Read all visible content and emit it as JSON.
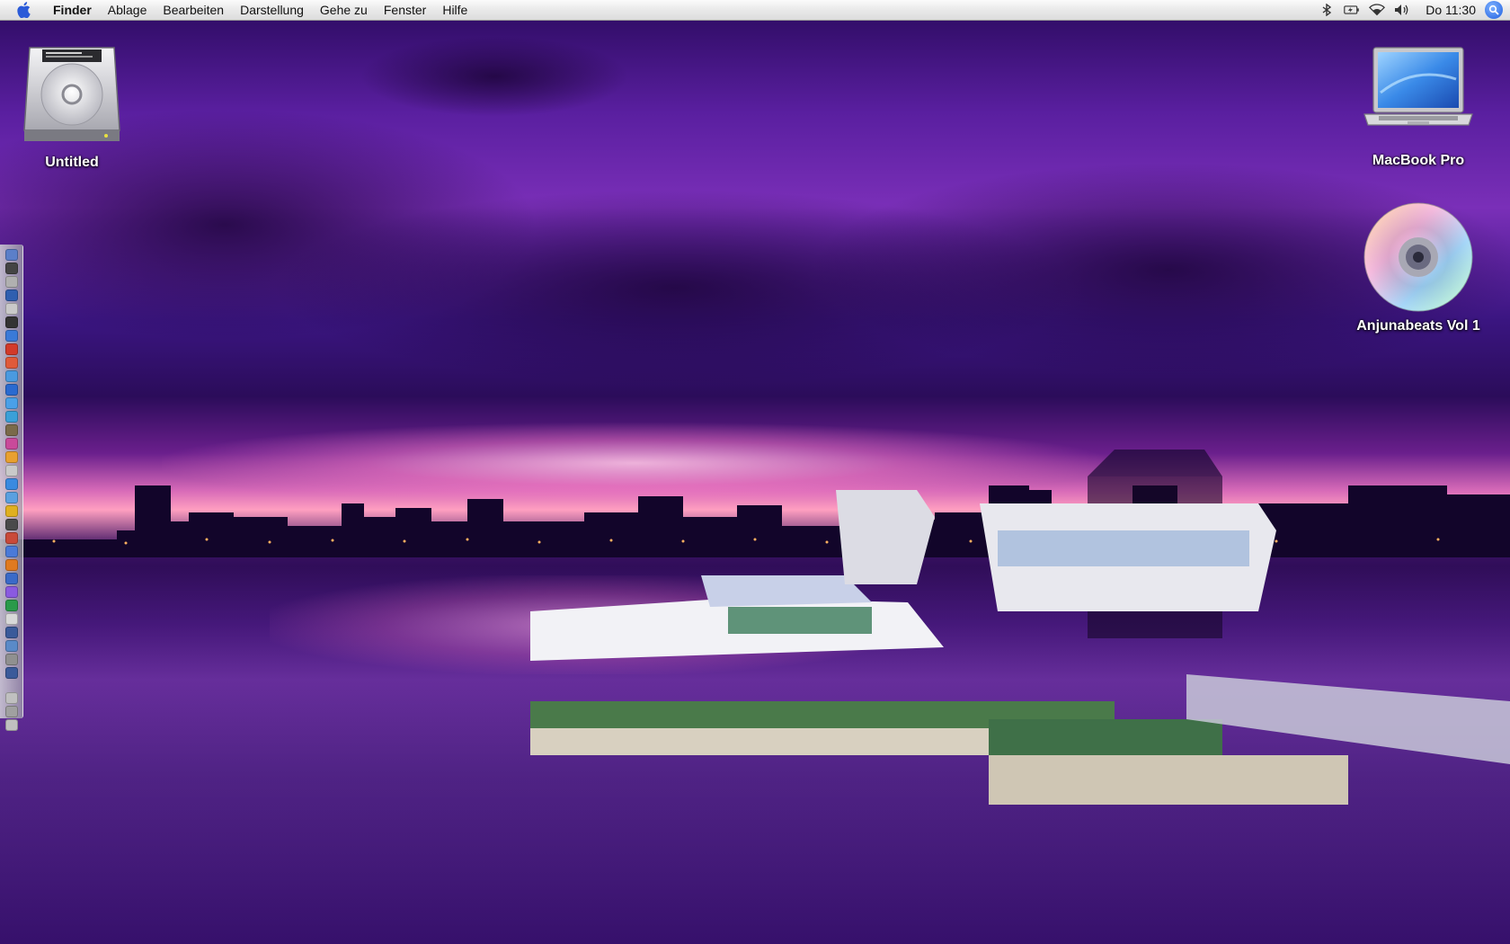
{
  "menubar": {
    "app_name": "Finder",
    "items": [
      "Ablage",
      "Bearbeiten",
      "Darstellung",
      "Gehe zu",
      "Fenster",
      "Hilfe"
    ],
    "clock": "Do 11:30",
    "status_icons": [
      "bluetooth-icon",
      "battery-icon",
      "wifi-icon",
      "volume-icon",
      "spotlight-icon"
    ]
  },
  "desktop": {
    "icons": {
      "hard_drive": {
        "label": "Untitled",
        "icon": "hard-drive-icon"
      },
      "computer": {
        "label": "MacBook Pro",
        "icon": "laptop-icon"
      },
      "disc": {
        "label": "Anjunabeats Vol 1",
        "icon": "cd-icon"
      }
    }
  },
  "dock": {
    "position": "left",
    "item_colors": [
      "#5b7fc9",
      "#444444",
      "#b0b0b0",
      "#2f5fb0",
      "#c9c9c9",
      "#333333",
      "#3a7ad8",
      "#d23a2a",
      "#e05a3a",
      "#4a9ae0",
      "#2a6ad0",
      "#4aa0e8",
      "#3aa0d8",
      "#7a6a4a",
      "#c94a9a",
      "#e8a030",
      "#c9c9c9",
      "#3a8ae0",
      "#5aa0e0",
      "#e0b020",
      "#4a4a4a",
      "#c94a3a",
      "#4a7ad8",
      "#e07a20",
      "#3a6ac8",
      "#8a5ae0",
      "#2a9a4a",
      "#d8d8d8",
      "#3a5a9a",
      "#5a8ac8",
      "#909090",
      "#3a5a9a"
    ],
    "tail_item_colors": [
      "#c0c0c0",
      "#a0a0a0",
      "#c0c0c0"
    ]
  },
  "colors": {
    "menubar_bg": "#e9e9e9",
    "icon_label": "#ffffff",
    "wallpaper_primary": "#5a1fa0"
  }
}
